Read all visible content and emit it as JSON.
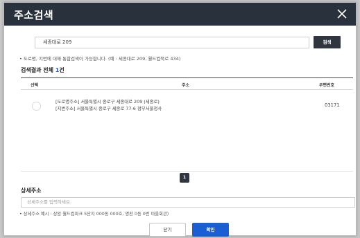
{
  "dialog": {
    "title": "주소검색"
  },
  "search": {
    "value": "세종대로 209",
    "button_label": "검색"
  },
  "hint": "• 도로명, 지번에 대해 통합검색이 가능합니다. (예 : 세종대로 209, 월드컵북로 434)",
  "results": {
    "title_prefix": "검색결과 전체 ",
    "count": "1",
    "title_suffix": "건",
    "columns": {
      "select": "선택",
      "address": "주소",
      "zip": "우편번호"
    },
    "rows": [
      {
        "road_address": "[도로명주소] 서울특별시 종로구 세종대로 209 (세종로)",
        "jibun_address": "[지번주소] 서울특별시 종로구 세종로 77-6 정부서울청사",
        "zip": "03171"
      }
    ]
  },
  "pagination": {
    "current_page": "1"
  },
  "detail": {
    "title": "상세주소",
    "placeholder": "상세주소를 입력하세요.",
    "hint": "• 상세주소 예시 : 상암 월드컵파크 5단지 000동 000호, 명전 0동 0번 마을회관)"
  },
  "footer": {
    "close_label": "닫기",
    "confirm_label": "확인"
  },
  "icons": {
    "close": "close-icon",
    "radio": "radio-button"
  },
  "colors": {
    "titlebar": "#29313c",
    "accent": "#1a5fd1",
    "count": "#1e5cc4"
  }
}
